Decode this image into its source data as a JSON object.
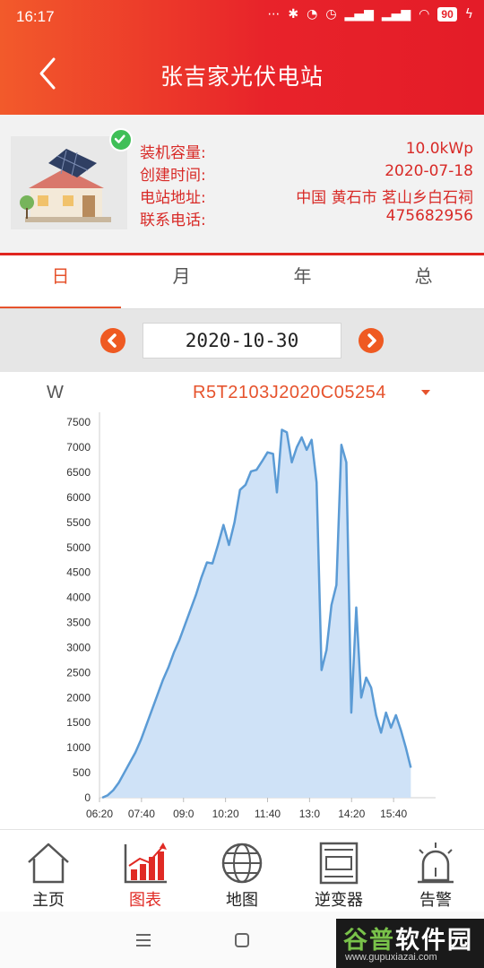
{
  "status_bar": {
    "time": "16:17",
    "battery": "90"
  },
  "header": {
    "title": "张吉家光伏电站"
  },
  "station": {
    "rows": [
      {
        "key": "装机容量:",
        "value": "10.0kWp"
      },
      {
        "key": "创建时间:",
        "value": "2020-07-18"
      },
      {
        "key": "电站地址:",
        "value": "中国 黄石市 茗山乡白石祠"
      },
      {
        "key": "联系电话:",
        "value": "475682956"
      }
    ]
  },
  "tabs": [
    {
      "label": "日",
      "active": true
    },
    {
      "label": "月",
      "active": false
    },
    {
      "label": "年",
      "active": false
    },
    {
      "label": "总",
      "active": false
    }
  ],
  "date_picker": {
    "date": "2020-10-30"
  },
  "chart_head": {
    "unit": "W",
    "device": "R5T2103J2020C05254"
  },
  "chart_data": {
    "type": "area",
    "ylabel": "W",
    "ylim": [
      0,
      7700
    ],
    "yticks": [
      0,
      500,
      1000,
      1500,
      2000,
      2500,
      3000,
      3500,
      4000,
      4500,
      5000,
      5500,
      6000,
      6500,
      7000,
      7500
    ],
    "xticks": [
      "06:20",
      "07:40",
      "09:0",
      "10:20",
      "11:40",
      "13:0",
      "14:20",
      "15:40"
    ],
    "xlim": [
      375,
      985
    ],
    "series_color": "#5b9bd5",
    "fill_color": "#cfe2f7",
    "grid": false,
    "points": [
      [
        380,
        0
      ],
      [
        390,
        50
      ],
      [
        400,
        150
      ],
      [
        410,
        300
      ],
      [
        420,
        500
      ],
      [
        430,
        700
      ],
      [
        440,
        900
      ],
      [
        450,
        1150
      ],
      [
        460,
        1450
      ],
      [
        470,
        1750
      ],
      [
        480,
        2050
      ],
      [
        490,
        2350
      ],
      [
        500,
        2600
      ],
      [
        510,
        2900
      ],
      [
        520,
        3150
      ],
      [
        530,
        3450
      ],
      [
        540,
        3750
      ],
      [
        550,
        4050
      ],
      [
        560,
        4400
      ],
      [
        570,
        4700
      ],
      [
        580,
        4680
      ],
      [
        590,
        5050
      ],
      [
        600,
        5450
      ],
      [
        610,
        5050
      ],
      [
        620,
        5500
      ],
      [
        630,
        6150
      ],
      [
        640,
        6250
      ],
      [
        650,
        6520
      ],
      [
        660,
        6550
      ],
      [
        670,
        6720
      ],
      [
        680,
        6900
      ],
      [
        690,
        6870
      ],
      [
        697,
        6100
      ],
      [
        706,
        7350
      ],
      [
        715,
        7300
      ],
      [
        724,
        6700
      ],
      [
        733,
        7000
      ],
      [
        742,
        7200
      ],
      [
        751,
        6950
      ],
      [
        760,
        7150
      ],
      [
        769,
        6300
      ],
      [
        778,
        2550
      ],
      [
        787,
        2950
      ],
      [
        796,
        3850
      ],
      [
        805,
        4250
      ],
      [
        814,
        7050
      ],
      [
        823,
        6700
      ],
      [
        832,
        1700
      ],
      [
        841,
        3800
      ],
      [
        850,
        2000
      ],
      [
        859,
        2400
      ],
      [
        868,
        2200
      ],
      [
        877,
        1650
      ],
      [
        886,
        1300
      ],
      [
        895,
        1700
      ],
      [
        904,
        1400
      ],
      [
        913,
        1650
      ],
      [
        922,
        1350
      ],
      [
        931,
        1000
      ],
      [
        940,
        600
      ]
    ]
  },
  "bottom_nav": [
    {
      "label": "主页",
      "icon": "home-icon",
      "active": false
    },
    {
      "label": "图表",
      "icon": "chart-icon",
      "active": true
    },
    {
      "label": "地图",
      "icon": "globe-icon",
      "active": false
    },
    {
      "label": "逆变器",
      "icon": "inverter-icon",
      "active": false
    },
    {
      "label": "告警",
      "icon": "alarm-icon",
      "active": false
    }
  ],
  "watermark": {
    "title_a": "谷普",
    "title_b": "软件园",
    "url": "www.gupuxiazai.com"
  }
}
